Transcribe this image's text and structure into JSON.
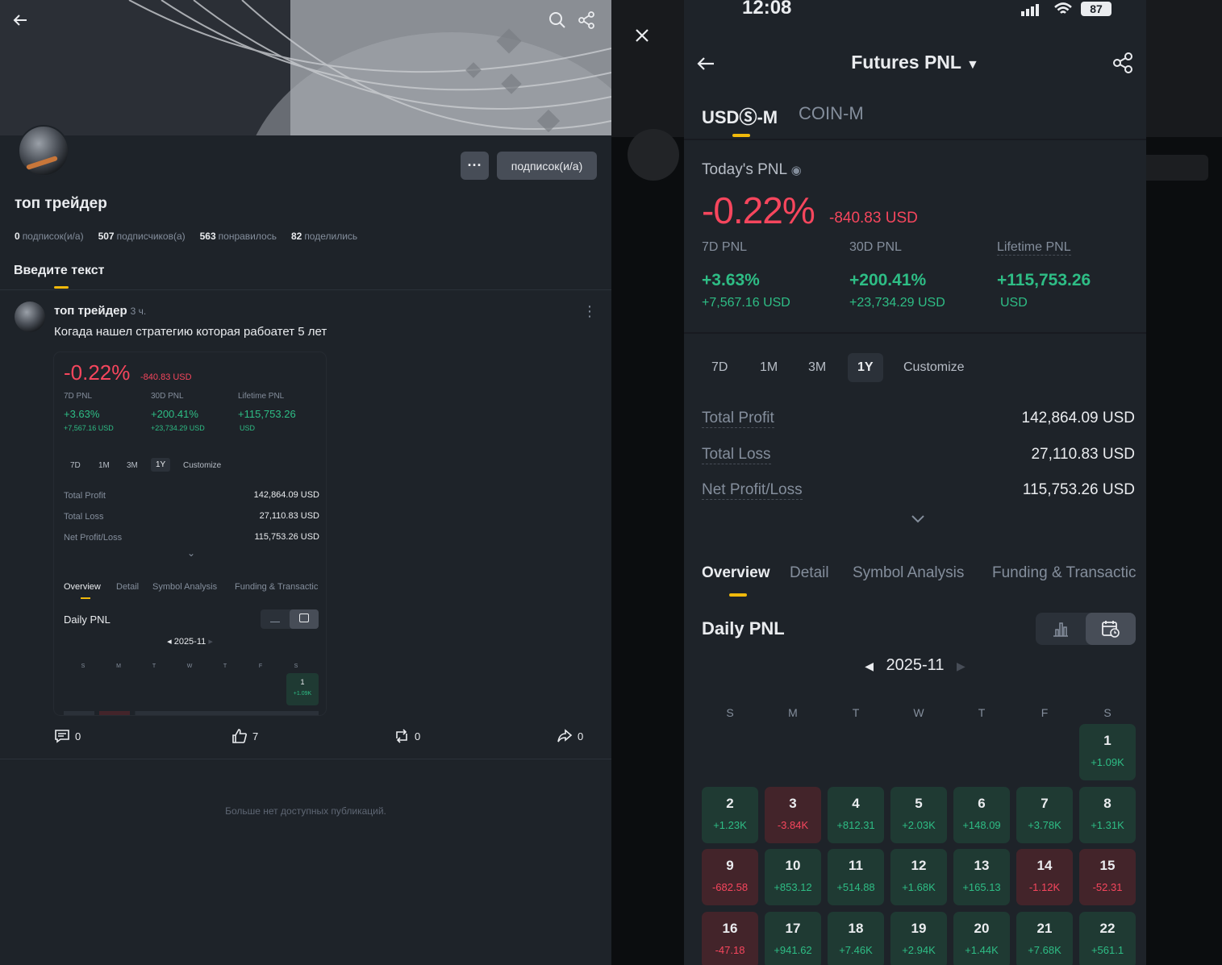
{
  "left": {
    "profile_name": "топ трейдер",
    "follow_button": "подписок(и/а)",
    "more_button": "···",
    "stats": [
      {
        "num": "0",
        "label": "подписок(и/а)"
      },
      {
        "num": "507",
        "label": "подписчиков(а)"
      },
      {
        "num": "563",
        "label": "понравилось"
      },
      {
        "num": "82",
        "label": "поделились"
      }
    ],
    "tab_label": "Введите текст",
    "post": {
      "author": "топ трейдер",
      "time": "3 ч.",
      "text": "Когада нашел стратегию которая рабоатет 5 лет",
      "comments": "0",
      "likes": "7",
      "reposts": "0",
      "shares": "0"
    },
    "no_more": "Больше нет доступных публикаций."
  },
  "pnl": {
    "status_time": "12:08",
    "battery": "87",
    "title": "Futures PNL",
    "tabs": [
      "USDⓈ-M",
      "COIN-M"
    ],
    "today_label": "Today's PNL",
    "today_pct": "-0.22%",
    "today_usd": "-840.83 USD",
    "kpis": [
      {
        "label": "7D PNL",
        "value": "+3.63%",
        "sub": "+7,567.16 USD"
      },
      {
        "label": "30D PNL",
        "value": "+200.41%",
        "sub": "+23,734.29 USD"
      },
      {
        "label": "Lifetime PNL",
        "value": "+115,753.26",
        "sub": "USD"
      }
    ],
    "ranges": [
      "7D",
      "1M",
      "3M",
      "1Y",
      "Customize"
    ],
    "active_range": "1Y",
    "summary": [
      {
        "label": "Total Profit",
        "value": "142,864.09 USD"
      },
      {
        "label": "Total Loss",
        "value": "27,110.83 USD"
      },
      {
        "label": "Net Profit/Loss",
        "value": "115,753.26 USD"
      }
    ],
    "overview_tabs": [
      "Overview",
      "Detail",
      "Symbol Analysis",
      "Funding & Transactic"
    ],
    "daily_title": "Daily PNL",
    "month": "2025-11",
    "weekdays": [
      "S",
      "M",
      "T",
      "W",
      "T",
      "F",
      "S"
    ],
    "days": [
      {
        "d": "1",
        "v": "+1.09K",
        "s": "pos"
      },
      {
        "d": "2",
        "v": "+1.23K",
        "s": "pos"
      },
      {
        "d": "3",
        "v": "-3.84K",
        "s": "neg"
      },
      {
        "d": "4",
        "v": "+812.31",
        "s": "pos"
      },
      {
        "d": "5",
        "v": "+2.03K",
        "s": "pos"
      },
      {
        "d": "6",
        "v": "+148.09",
        "s": "pos"
      },
      {
        "d": "7",
        "v": "+3.78K",
        "s": "pos"
      },
      {
        "d": "8",
        "v": "+1.31K",
        "s": "pos"
      },
      {
        "d": "9",
        "v": "-682.58",
        "s": "neg"
      },
      {
        "d": "10",
        "v": "+853.12",
        "s": "pos"
      },
      {
        "d": "11",
        "v": "+514.88",
        "s": "pos"
      },
      {
        "d": "12",
        "v": "+1.68K",
        "s": "pos"
      },
      {
        "d": "13",
        "v": "+165.13",
        "s": "pos"
      },
      {
        "d": "14",
        "v": "-1.12K",
        "s": "neg"
      },
      {
        "d": "15",
        "v": "-52.31",
        "s": "neg"
      },
      {
        "d": "16",
        "v": "-47.18",
        "s": "neg"
      },
      {
        "d": "17",
        "v": "+941.62",
        "s": "pos"
      },
      {
        "d": "18",
        "v": "+7.46K",
        "s": "pos"
      },
      {
        "d": "19",
        "v": "+2.94K",
        "s": "pos"
      },
      {
        "d": "20",
        "v": "+1.44K",
        "s": "pos"
      },
      {
        "d": "21",
        "v": "+7.68K",
        "s": "pos"
      },
      {
        "d": "22",
        "v": "+561.1",
        "s": "pos"
      }
    ]
  },
  "colors": {
    "bg": "#1e2329",
    "accent": "#f0b90b",
    "positive": "#2ebd85",
    "negative": "#f6465d"
  }
}
